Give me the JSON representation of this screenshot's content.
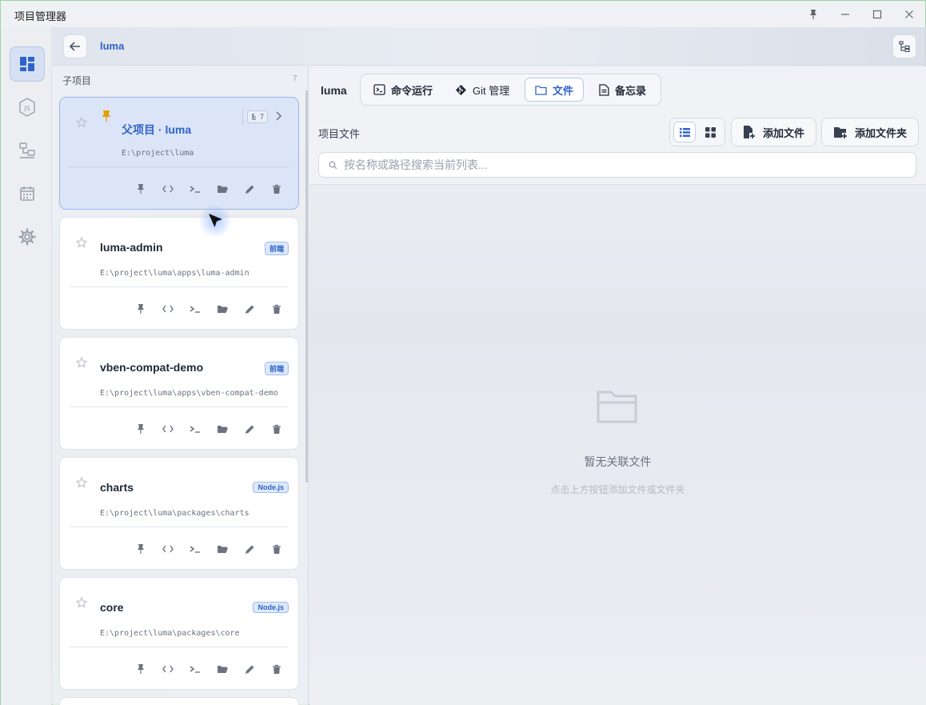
{
  "app": {
    "title": "项目管理器"
  },
  "header": {
    "title": "luma"
  },
  "sidebar": {
    "label": "子项目",
    "count": "7",
    "parent": {
      "name": "父项目 · luma",
      "path": "E:\\project\\luma",
      "subproject_count": "7"
    },
    "items": [
      {
        "name": "luma-admin",
        "path": "E:\\project\\luma\\apps\\luma-admin",
        "tag": "前端"
      },
      {
        "name": "vben-compat-demo",
        "path": "E:\\project\\luma\\apps\\vben-compat-demo",
        "tag": "前端"
      },
      {
        "name": "charts",
        "path": "E:\\project\\luma\\packages\\charts",
        "tag": "Node.js"
      },
      {
        "name": "core",
        "path": "E:\\project\\luma\\packages\\core",
        "tag": "Node.js"
      }
    ]
  },
  "main": {
    "project_name": "luma",
    "tabs": [
      {
        "label": "命令运行",
        "icon": "terminal-icon"
      },
      {
        "label": "Git 管理",
        "icon": "git-icon"
      },
      {
        "label": "文件",
        "icon": "folder-icon"
      },
      {
        "label": "备忘录",
        "icon": "note-icon"
      }
    ],
    "active_tab": "文件",
    "section_label": "项目文件",
    "view_mode": "list",
    "add_file_label": "添加文件",
    "add_folder_label": "添加文件夹",
    "search_placeholder": "按名称或路径搜索当前列表...",
    "empty_title": "暂无关联文件",
    "empty_hint": "点击上方按钮添加文件或文件夹"
  },
  "colors": {
    "accent": "#2f63c9",
    "pin": "#e3a008"
  }
}
